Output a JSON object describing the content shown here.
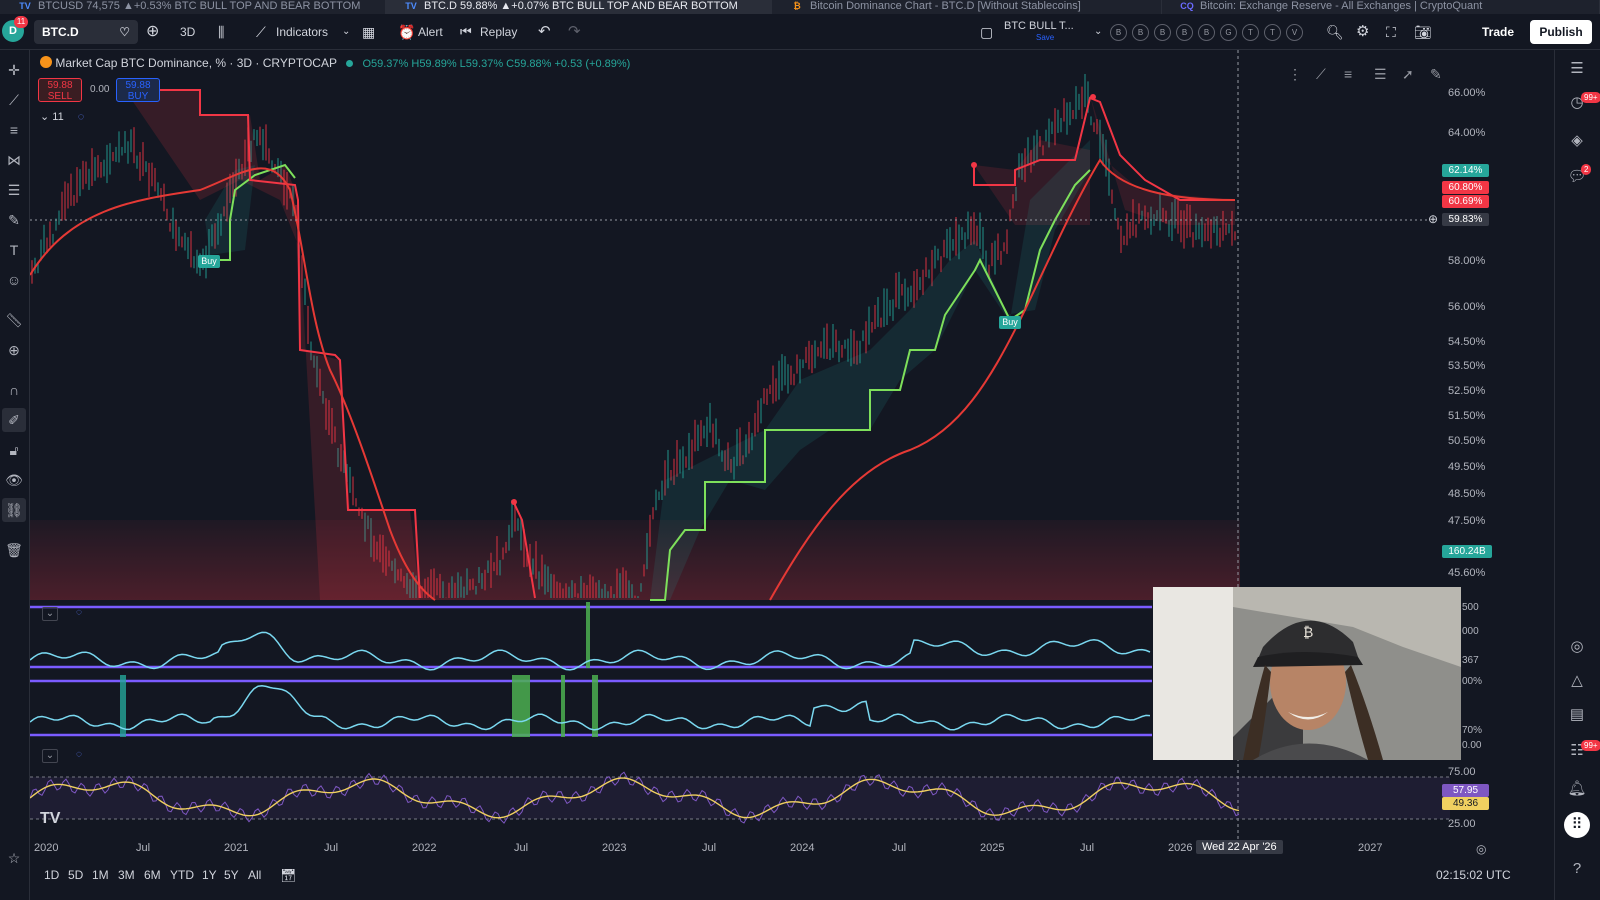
{
  "tabs": [
    {
      "label": "BTCUSD 74,575 ▲+0.53% BTC BULL TOP AND BEAR BOTTOM",
      "icon": "tradingview-icon",
      "active": false
    },
    {
      "label": "BTC.D 59.88% ▲+0.07% BTC BULL TOP AND BEAR BOTTOM",
      "icon": "tradingview-icon",
      "active": true
    },
    {
      "label": "Bitcoin Dominance Chart - BTC.D [Without Stablecoins]",
      "icon": "bitcoin-icon",
      "active": false
    },
    {
      "label": "Bitcoin: Exchange Reserve - All Exchanges | CryptoQuant",
      "icon": "cryptoquant-icon",
      "active": false
    }
  ],
  "toolbar": {
    "notif_count": "11",
    "symbol": "BTC.D",
    "interval": "3D",
    "indicators_label": "Indicators",
    "alert_label": "Alert",
    "replay_label": "Replay",
    "layout_name": "BTC BULL T...",
    "save_label": "Save",
    "compare_letters": [
      "B",
      "B",
      "B",
      "B",
      "B",
      "G",
      "T",
      "T",
      "V"
    ],
    "trade_label": "Trade",
    "publish_label": "Publish"
  },
  "legend": {
    "title": "Market Cap BTC Dominance, % · 3D · CRYPTOCAP",
    "ohlc": "O59.37% H59.89% L59.37% C59.88% +0.53 (+0.89%)",
    "sell_price": "59.88",
    "sell_label": "SELL",
    "spread": "0.00",
    "buy_price": "59.88",
    "buy_label": "BUY",
    "collapse_count": "11"
  },
  "price_axis": [
    "66.00%",
    "64.00%",
    "58.00%",
    "56.00%",
    "54.50%",
    "53.50%",
    "52.50%",
    "51.50%",
    "50.50%",
    "49.50%",
    "48.50%",
    "47.50%",
    "45.60%"
  ],
  "price_tags": [
    {
      "value": "62.14%",
      "color": "#26a69a"
    },
    {
      "value": "60.80%",
      "color": "#f23645"
    },
    {
      "value": "60.69%",
      "color": "#f23645"
    },
    {
      "value": "59.83%",
      "color": "#363a45"
    },
    {
      "value": "160.24B",
      "color": "#26a69a"
    }
  ],
  "pane_labels": {
    "osc1": [
      "500",
      "000",
      "367",
      "00%",
      "70%",
      "0.00"
    ],
    "rsi": [
      "75.00",
      "57.95",
      "49.36",
      "25.00"
    ]
  },
  "time_axis": [
    "2020",
    "Jul",
    "2021",
    "Jul",
    "2022",
    "Jul",
    "2023",
    "Jul",
    "2024",
    "Jul",
    "2025",
    "Jul",
    "2026",
    "Wed 22 Apr '26",
    "2027"
  ],
  "chart_labels": {
    "buy1": "Buy",
    "buy2": "Buy"
  },
  "timeframes": [
    "1D",
    "5D",
    "1M",
    "3M",
    "6M",
    "YTD",
    "1Y",
    "5Y",
    "All"
  ],
  "clock": "02:15:02 UTC",
  "right_badges": {
    "alerts": "99+",
    "chat": "2",
    "notifs": "99+"
  },
  "colors": {
    "bg": "#131722",
    "bull": "#26a69a",
    "bear": "#f23645",
    "green_line": "#7ee05b",
    "red_line": "#e53935",
    "osc": "#7ad8f0",
    "band": "#7b5cff"
  }
}
